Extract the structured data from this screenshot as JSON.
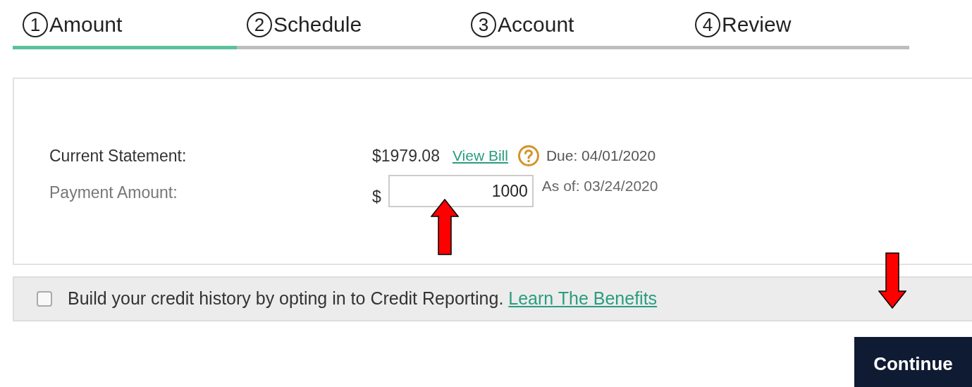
{
  "steps": [
    {
      "number": "1",
      "label": "Amount",
      "selected": true
    },
    {
      "number": "2",
      "label": "Schedule",
      "selected": false
    },
    {
      "number": "3",
      "label": "Account",
      "selected": false
    },
    {
      "number": "4",
      "label": "Review",
      "selected": false
    }
  ],
  "statement": {
    "label": "Current Statement:",
    "amount": "$1979.08",
    "link": "View Bill",
    "due": "Due: 04/01/2020"
  },
  "payment": {
    "label": "Payment Amount:",
    "currency": "$",
    "value": "1000",
    "as_of": "As of: 03/24/2020"
  },
  "credit_reporting": {
    "checked": false,
    "text": "Build your credit history by opting in to Credit Reporting.",
    "link": "Learn The Benefits"
  },
  "continue_button": "Continue"
}
